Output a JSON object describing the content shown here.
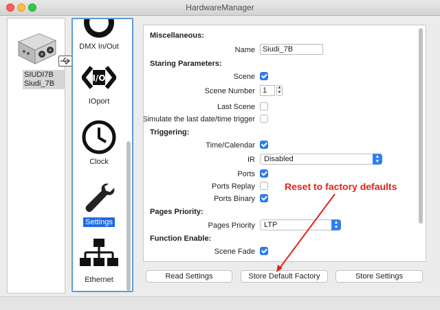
{
  "window": {
    "title": "HardwareManager"
  },
  "device": {
    "name_line1": "SIUDI7B",
    "name_line2": "Siudi_7B",
    "icon": "interface-box-icon",
    "connection_icon": "usb-icon"
  },
  "categories": [
    {
      "label": "DMX In/Out",
      "icon": "dmx-icon"
    },
    {
      "label": "IOport",
      "icon": "io-code-icon"
    },
    {
      "label": "Clock",
      "icon": "clock-icon"
    },
    {
      "label": "Settings",
      "icon": "wrench-icon",
      "selected": true
    },
    {
      "label": "Ethernet",
      "icon": "network-icon"
    }
  ],
  "settings": {
    "miscellaneous": "Miscellaneous:",
    "name_label": "Name",
    "name_value": "Siudi_7B",
    "starting_parameters": "Staring Parameters:",
    "scene_label": "Scene",
    "scene_checked": true,
    "scene_number_label": "Scene Number",
    "scene_number_value": "1",
    "last_scene_label": "Last Scene",
    "last_scene_checked": false,
    "simulate_label": "Simulate the last date/time trigger",
    "simulate_checked": false,
    "triggering": "Triggering:",
    "time_calendar_label": "Time/Calendar",
    "time_calendar_checked": true,
    "ir_label": "IR",
    "ir_value": "Disabled",
    "ports_label": "Ports",
    "ports_checked": true,
    "ports_replay_label": "Ports Replay",
    "ports_replay_checked": false,
    "ports_binary_label": "Ports Binary",
    "ports_binary_checked": true,
    "pages_priority_section": "Pages Priority:",
    "pages_priority_label": "Pages Priority",
    "pages_priority_value": "LTP",
    "function_enable": "Function Enable:",
    "scene_fade_label": "Scene Fade",
    "scene_fade_checked": true
  },
  "buttons": {
    "read": "Read Settings",
    "store_default": "Store Default Factory",
    "store": "Store Settings"
  },
  "annotation": {
    "text": "Reset to factory defaults",
    "color": "#e62117"
  }
}
